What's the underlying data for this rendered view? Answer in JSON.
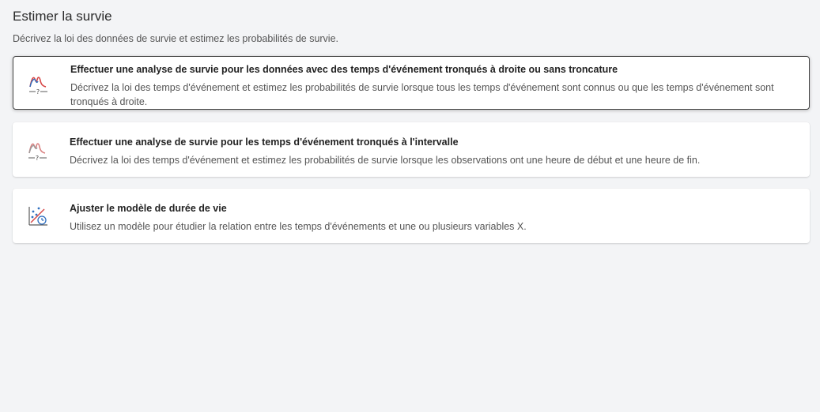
{
  "page": {
    "title": "Estimer la survie",
    "subtitle": "Décrivez la loi des données de survie et estimez les probabilités de survie."
  },
  "cards": [
    {
      "title": "Effectuer une analyse de survie pour les données avec des temps d'événement tronqués à droite ou sans troncature",
      "description": "Décrivez la loi des temps d'événement et estimez les probabilités de survie lorsque tous les temps d'événement sont connus ou que les temps d'événement sont tronqués à droite.",
      "icon": "survival-curve-icon",
      "selected": true
    },
    {
      "title": "Effectuer une analyse de survie pour les temps d'événement tronqués à l'intervalle",
      "description": "Décrivez la loi des temps d'événement et estimez les probabilités de survie lorsque les observations ont une heure de début et une heure de fin.",
      "icon": "survival-interval-icon",
      "selected": false
    },
    {
      "title": "Ajuster le modèle de durée de vie",
      "description": "Utilisez un modèle pour étudier la relation entre les temps d'événements et une ou plusieurs variables X.",
      "icon": "lifetime-model-icon",
      "selected": false
    }
  ],
  "colors": {
    "background": "#f3f4f6",
    "card": "#ffffff",
    "icon_red": "#d64545",
    "icon_blue": "#2f6fbf",
    "icon_gray": "#5a5a5a"
  }
}
